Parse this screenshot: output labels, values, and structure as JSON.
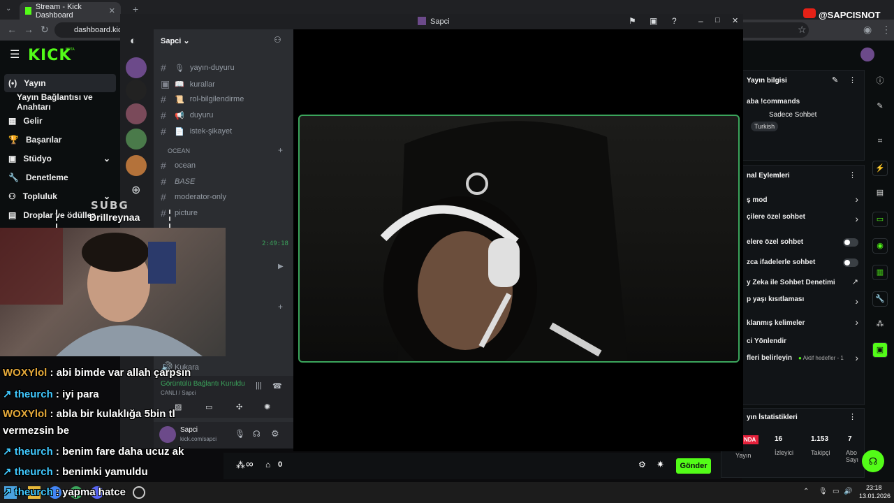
{
  "browser": {
    "tab_title": "Stream - Kick Dashboard",
    "url": "dashboard.kick.c",
    "yt_handle": "@SAPCISNOT"
  },
  "kick": {
    "logo": "KICK",
    "logo_sup": "BETA",
    "sidebar": [
      {
        "label": "Yayın",
        "icon": "broadcast-icon"
      },
      {
        "label": "Yayın Bağlantısı ve Anahtarı",
        "icon": ""
      },
      {
        "label": "Gelir",
        "icon": "revenue-icon"
      },
      {
        "label": "Başarılar",
        "icon": "trophy-icon"
      },
      {
        "label": "Stüdyo",
        "icon": "studio-icon"
      },
      {
        "label": "Denetleme",
        "icon": "wrench-icon"
      },
      {
        "label": "Topluluk",
        "icon": "community-icon"
      },
      {
        "label": "Droplar ve ödüller",
        "icon": "drops-icon"
      }
    ],
    "stream_info": {
      "title": "Yayın bilgisi",
      "commands": "aba !commands",
      "category": "Sadece Sohbet",
      "tag": "Turkish"
    },
    "channel_actions": {
      "title": "nal Eylemleri",
      "rows": [
        {
          "label": "ş mod",
          "control": "chevron"
        },
        {
          "label": "çilere özel sohbet",
          "control": "chevron"
        },
        {
          "label": "elere özel sohbet",
          "control": "toggle"
        },
        {
          "label": "zca ifadelerle sohbet",
          "control": "toggle"
        },
        {
          "label": "y Zeka ile Sohbet Denetimi",
          "control": "external"
        },
        {
          "label": "p yaşı kısıtlaması",
          "control": "chevron"
        },
        {
          "label": "klanmış kelimeler",
          "control": "chevron"
        },
        {
          "label": "ci Yönlendir",
          "control": "none"
        },
        {
          "label": "fleri belirleyin",
          "control": "chevron",
          "badge": "Aktif hedefler - 1"
        }
      ]
    },
    "stats": {
      "title": "yın İstatistikleri",
      "live_badge": "NDA",
      "items": [
        {
          "value": "",
          "label": "Yayın"
        },
        {
          "value": "16",
          "label": "İzleyici"
        },
        {
          "value": "1.153",
          "label": "Takipçi"
        },
        {
          "value": "7",
          "label": "Abo Sayı"
        }
      ]
    },
    "chat_bar": {
      "infinity": "∞",
      "count": "0",
      "send": "Gönder"
    }
  },
  "discord": {
    "window_title": "Sapci",
    "server_name": "Sapci",
    "channels": [
      {
        "name": "yayın-duyuru",
        "emoji": "🎙"
      },
      {
        "name": "kurallar",
        "emoji": "📖"
      },
      {
        "name": "rol-bilgilendirme",
        "emoji": "📜"
      },
      {
        "name": "duyuru",
        "emoji": "📢"
      },
      {
        "name": "istek-şikayet",
        "emoji": "📄"
      }
    ],
    "category": "OCEAN",
    "ocean_channels": [
      "ocean",
      "BASE",
      "moderator-only",
      "picture"
    ],
    "timer": "2:49:18",
    "voice_user": "Kukara",
    "connection_status": "Görüntülü Bağlantı Kuruldu",
    "connection_sub": "CANLI / Sapci",
    "user": {
      "name": "Sapci",
      "status": "kick.com/sapci"
    }
  },
  "overlay": {
    "sub_label": "SUBG",
    "sub_name": "Drillreynaa"
  },
  "chat": [
    {
      "user": "WOXYlol",
      "msg": "abi bimde var allah çarpsın",
      "color": "orange",
      "badge": false
    },
    {
      "user": "theurch",
      "msg": "iyi para",
      "color": "blue",
      "badge": true
    },
    {
      "user": "WOXYlol",
      "msg": "abla bir kulaklığa 5bin tl",
      "color": "orange",
      "badge": false
    },
    {
      "user": "",
      "msg": "vermezsin be",
      "color": "white",
      "badge": false
    },
    {
      "user": "theurch",
      "msg": "benim fare daha ucuz ak",
      "color": "blue",
      "badge": true
    },
    {
      "user": "theurch",
      "msg": "benimki yamuldu",
      "color": "blue",
      "badge": true
    },
    {
      "user": "theurch",
      "msg": "yapma hatce",
      "color": "blue",
      "badge": true
    }
  ],
  "taskbar": {
    "time": "23:18",
    "date": "13.01.2026"
  }
}
